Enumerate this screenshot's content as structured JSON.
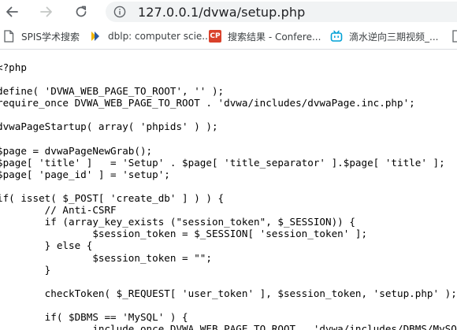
{
  "browser": {
    "url": "127.0.0.1/dvwa/setup.php",
    "bookmarks": [
      {
        "label": "SPIS学术搜索",
        "icon": "bookmark-page-icon"
      },
      {
        "label": "dblp: computer scie...",
        "icon": "dblp-logo-icon"
      },
      {
        "label": "搜索结果 - Confere...",
        "icon": "cp-logo-icon"
      },
      {
        "label": "滴水逆向三期视频_...",
        "icon": "bilibili-tv-icon"
      },
      {
        "label": "",
        "icon": "bookmark-page-icon"
      }
    ]
  },
  "code": {
    "lines": [
      "<?php",
      "",
      "define( 'DVWA_WEB_PAGE_TO_ROOT', '' );",
      "require_once DVWA_WEB_PAGE_TO_ROOT . 'dvwa/includes/dvwaPage.inc.php';",
      "",
      "dvwaPageStartup( array( 'phpids' ) );",
      "",
      "$page = dvwaPageNewGrab();",
      "$page[ 'title' ]   = 'Setup' . $page[ 'title_separator' ].$page[ 'title' ];",
      "$page[ 'page_id' ] = 'setup';",
      "",
      "if( isset( $_POST[ 'create_db' ] ) ) {",
      "        // Anti-CSRF",
      "        if (array_key_exists (\"session_token\", $_SESSION)) {",
      "                $session_token = $_SESSION[ 'session_token' ];",
      "        } else {",
      "                $session_token = \"\";",
      "        }",
      "",
      "        checkToken( $_REQUEST[ 'user_token' ], $session_token, 'setup.php' );",
      "",
      "        if( $DBMS == 'MySQL' ) {",
      "                include_once DVWA_WEB_PAGE_TO_ROOT . 'dvwa/includes/DBMS/MySQL.php';"
    ]
  }
}
